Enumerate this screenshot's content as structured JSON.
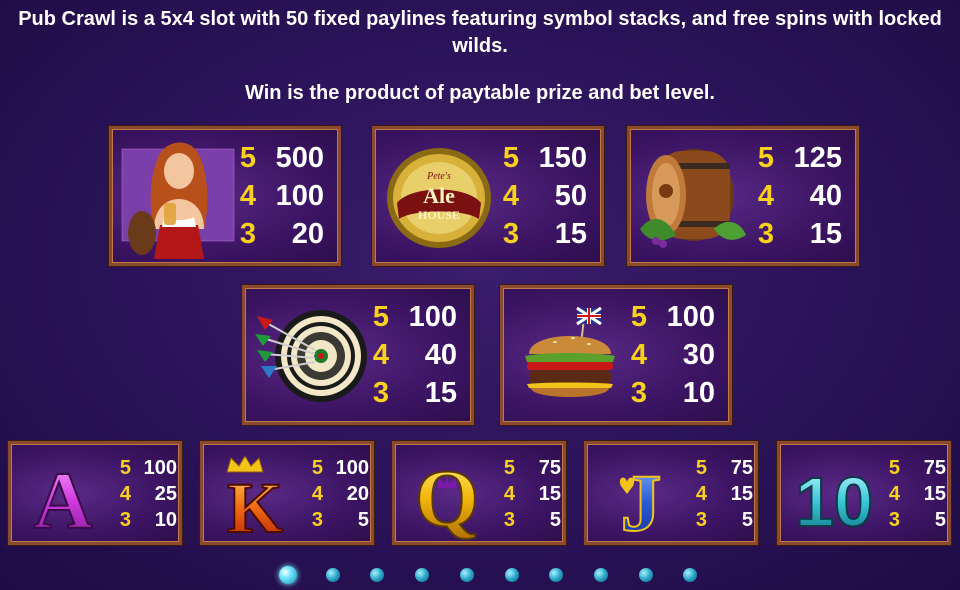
{
  "intro": {
    "line1": "Pub Crawl is a 5x4 slot with 50 fixed paylines featuring symbol stacks, and free spins with locked",
    "line2": "wilds.",
    "rule": "Win is the product of paytable prize and bet level."
  },
  "colors": {
    "count": "#f8d11c",
    "value": "#ffffff",
    "frame": "#8a4a2b"
  },
  "symbols": [
    {
      "name": "barmaid",
      "icon": "barmaid-icon",
      "pays": [
        {
          "count": "5",
          "value": "500"
        },
        {
          "count": "4",
          "value": "100"
        },
        {
          "count": "3",
          "value": "20"
        }
      ]
    },
    {
      "name": "ale-house",
      "icon": "ale-house-sign-icon",
      "sign_top": "Pete's",
      "sign_mid": "Ale",
      "sign_bottom": "HOUSE",
      "pays": [
        {
          "count": "5",
          "value": "150"
        },
        {
          "count": "4",
          "value": "50"
        },
        {
          "count": "3",
          "value": "15"
        }
      ]
    },
    {
      "name": "barrel",
      "icon": "barrel-icon",
      "pays": [
        {
          "count": "5",
          "value": "125"
        },
        {
          "count": "4",
          "value": "40"
        },
        {
          "count": "3",
          "value": "15"
        }
      ]
    },
    {
      "name": "darts",
      "icon": "dartboard-icon",
      "pays": [
        {
          "count": "5",
          "value": "100"
        },
        {
          "count": "4",
          "value": "40"
        },
        {
          "count": "3",
          "value": "15"
        }
      ]
    },
    {
      "name": "burger",
      "icon": "burger-icon",
      "pays": [
        {
          "count": "5",
          "value": "100"
        },
        {
          "count": "4",
          "value": "30"
        },
        {
          "count": "3",
          "value": "10"
        }
      ]
    },
    {
      "name": "ace",
      "glyph": "A",
      "pays": [
        {
          "count": "5",
          "value": "100"
        },
        {
          "count": "4",
          "value": "25"
        },
        {
          "count": "3",
          "value": "10"
        }
      ]
    },
    {
      "name": "king",
      "glyph": "K",
      "pays": [
        {
          "count": "5",
          "value": "100"
        },
        {
          "count": "4",
          "value": "20"
        },
        {
          "count": "3",
          "value": "5"
        }
      ]
    },
    {
      "name": "queen",
      "glyph": "Q",
      "pays": [
        {
          "count": "5",
          "value": "75"
        },
        {
          "count": "4",
          "value": "15"
        },
        {
          "count": "3",
          "value": "5"
        }
      ]
    },
    {
      "name": "jack",
      "glyph": "J",
      "pays": [
        {
          "count": "5",
          "value": "75"
        },
        {
          "count": "4",
          "value": "15"
        },
        {
          "count": "3",
          "value": "5"
        }
      ]
    },
    {
      "name": "ten",
      "glyph": "10",
      "pays": [
        {
          "count": "5",
          "value": "75"
        },
        {
          "count": "4",
          "value": "15"
        },
        {
          "count": "3",
          "value": "5"
        }
      ]
    }
  ],
  "pagination": {
    "total": 10,
    "current": 1
  }
}
